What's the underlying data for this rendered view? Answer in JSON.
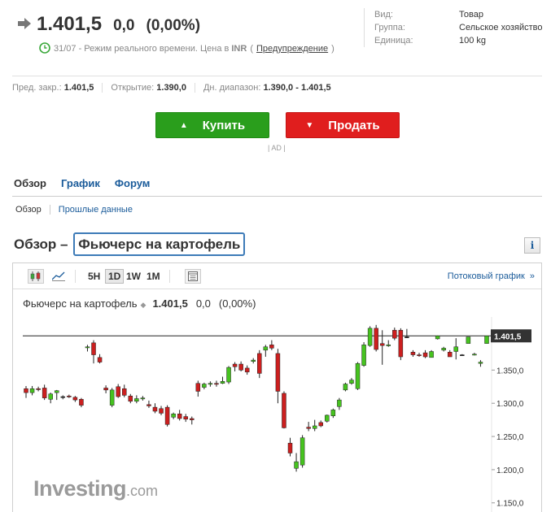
{
  "quote": {
    "price": "1.401,5",
    "change": "0,0",
    "change_pct": "(0,00%)",
    "time_text": "31/07 - Режим реального времени. Цена в",
    "currency": "INR",
    "paren_open": "(",
    "warning_link": "Предупреждение",
    "paren_close": ")"
  },
  "meta": [
    {
      "k": "Вид:",
      "v": "Товар"
    },
    {
      "k": "Группа:",
      "v": "Сельское хозяйство"
    },
    {
      "k": "Единица:",
      "v": "100 kg"
    }
  ],
  "stats": {
    "prev_label": "Пред. закр.:",
    "prev_value": "1.401,5",
    "open_label": "Открытие:",
    "open_value": "1.390,0",
    "range_label": "Дн. диапазон:",
    "range_value": "1.390,0 - 1.401,5"
  },
  "buttons": {
    "buy": "Купить",
    "sell": "Продать",
    "ad": "| AD |"
  },
  "tabs": [
    "Обзор",
    "График",
    "Форум"
  ],
  "subtabs": [
    "Обзор",
    "Прошлые данные"
  ],
  "section": {
    "prefix": "Обзор –",
    "title": "Фьючерс на картофель"
  },
  "info_label": "i",
  "chart_toolbar": {
    "timeframes": [
      "5H",
      "1D",
      "1W",
      "1M"
    ],
    "selected": "1D",
    "stream_link": "Потоковый график",
    "stream_chev": "»"
  },
  "chart_legend": {
    "name": "Фьючерс на картофель",
    "price": "1.401,5",
    "change": "0,0",
    "change_pct": "(0,00%)"
  },
  "watermark": {
    "main": "Investing",
    "suffix": ".com"
  },
  "colors": {
    "up": "#46c31f",
    "down": "#cc1f1f",
    "buy": "#2a9e1c",
    "sell": "#e01e1e",
    "link": "#1a5b9a"
  },
  "chart_data": {
    "type": "candlestick",
    "ylim": [
      1135,
      1430
    ],
    "y_ticks": [
      1150,
      1200,
      1250,
      1300,
      1350
    ],
    "y_tick_labels": [
      "1.150,0",
      "1.200,0",
      "1.250,0",
      "1.300,0",
      "1.350,0"
    ],
    "last_price": 1401.5,
    "last_price_label": "1.401,5",
    "candles": [
      {
        "o": 1322,
        "h": 1326,
        "l": 1308,
        "c": 1316
      },
      {
        "o": 1316,
        "h": 1326,
        "l": 1312,
        "c": 1322
      },
      {
        "o": 1322,
        "h": 1325,
        "l": 1318,
        "c": 1321
      },
      {
        "o": 1323,
        "h": 1328,
        "l": 1305,
        "c": 1308
      },
      {
        "o": 1306,
        "h": 1316,
        "l": 1300,
        "c": 1314
      },
      {
        "o": 1316,
        "h": 1320,
        "l": 1305,
        "c": 1319
      },
      {
        "o": 1310,
        "h": 1312,
        "l": 1306,
        "c": 1310
      },
      {
        "o": 1311,
        "h": 1313,
        "l": 1308,
        "c": 1310
      },
      {
        "o": 1309,
        "h": 1311,
        "l": 1302,
        "c": 1305
      },
      {
        "o": 1306,
        "h": 1308,
        "l": 1294,
        "c": 1297
      },
      {
        "o": 1384,
        "h": 1388,
        "l": 1378,
        "c": 1385
      },
      {
        "o": 1391,
        "h": 1395,
        "l": 1360,
        "c": 1373
      },
      {
        "o": 1369,
        "h": 1374,
        "l": 1360,
        "c": 1362
      },
      {
        "o": 1323,
        "h": 1327,
        "l": 1315,
        "c": 1320
      },
      {
        "o": 1297,
        "h": 1323,
        "l": 1294,
        "c": 1320
      },
      {
        "o": 1325,
        "h": 1329,
        "l": 1308,
        "c": 1310
      },
      {
        "o": 1322,
        "h": 1328,
        "l": 1309,
        "c": 1312
      },
      {
        "o": 1311,
        "h": 1314,
        "l": 1300,
        "c": 1303
      },
      {
        "o": 1303,
        "h": 1312,
        "l": 1300,
        "c": 1307
      },
      {
        "o": 1307,
        "h": 1311,
        "l": 1304,
        "c": 1308
      },
      {
        "o": 1298,
        "h": 1304,
        "l": 1293,
        "c": 1296
      },
      {
        "o": 1294,
        "h": 1300,
        "l": 1285,
        "c": 1288
      },
      {
        "o": 1292,
        "h": 1296,
        "l": 1282,
        "c": 1285
      },
      {
        "o": 1294,
        "h": 1297,
        "l": 1265,
        "c": 1268
      },
      {
        "o": 1279,
        "h": 1286,
        "l": 1276,
        "c": 1284
      },
      {
        "o": 1284,
        "h": 1290,
        "l": 1274,
        "c": 1277
      },
      {
        "o": 1280,
        "h": 1284,
        "l": 1272,
        "c": 1276
      },
      {
        "o": 1277,
        "h": 1280,
        "l": 1268,
        "c": 1275
      },
      {
        "o": 1330,
        "h": 1334,
        "l": 1310,
        "c": 1318
      },
      {
        "o": 1324,
        "h": 1331,
        "l": 1321,
        "c": 1329
      },
      {
        "o": 1329,
        "h": 1333,
        "l": 1325,
        "c": 1330
      },
      {
        "o": 1330,
        "h": 1334,
        "l": 1325,
        "c": 1329
      },
      {
        "o": 1330,
        "h": 1340,
        "l": 1329,
        "c": 1333
      },
      {
        "o": 1332,
        "h": 1356,
        "l": 1329,
        "c": 1354
      },
      {
        "o": 1359,
        "h": 1362,
        "l": 1348,
        "c": 1355
      },
      {
        "o": 1359,
        "h": 1363,
        "l": 1348,
        "c": 1350
      },
      {
        "o": 1353,
        "h": 1357,
        "l": 1343,
        "c": 1347
      },
      {
        "o": 1363,
        "h": 1368,
        "l": 1360,
        "c": 1365
      },
      {
        "o": 1375,
        "h": 1380,
        "l": 1338,
        "c": 1345
      },
      {
        "o": 1380,
        "h": 1388,
        "l": 1370,
        "c": 1385
      },
      {
        "o": 1388,
        "h": 1395,
        "l": 1380,
        "c": 1383
      },
      {
        "o": 1375,
        "h": 1382,
        "l": 1300,
        "c": 1318
      },
      {
        "o": 1315,
        "h": 1318,
        "l": 1262,
        "c": 1263
      },
      {
        "o": 1240,
        "h": 1248,
        "l": 1220,
        "c": 1225
      },
      {
        "o": 1202,
        "h": 1225,
        "l": 1197,
        "c": 1212
      },
      {
        "o": 1207,
        "h": 1252,
        "l": 1203,
        "c": 1248
      },
      {
        "o": 1264,
        "h": 1272,
        "l": 1258,
        "c": 1262
      },
      {
        "o": 1262,
        "h": 1275,
        "l": 1258,
        "c": 1266
      },
      {
        "o": 1271,
        "h": 1274,
        "l": 1264,
        "c": 1266
      },
      {
        "o": 1273,
        "h": 1283,
        "l": 1271,
        "c": 1282
      },
      {
        "o": 1281,
        "h": 1292,
        "l": 1278,
        "c": 1290
      },
      {
        "o": 1295,
        "h": 1308,
        "l": 1290,
        "c": 1305
      },
      {
        "o": 1320,
        "h": 1331,
        "l": 1318,
        "c": 1329
      },
      {
        "o": 1330,
        "h": 1338,
        "l": 1328,
        "c": 1335
      },
      {
        "o": 1322,
        "h": 1362,
        "l": 1320,
        "c": 1360
      },
      {
        "o": 1357,
        "h": 1392,
        "l": 1355,
        "c": 1388
      },
      {
        "o": 1387,
        "h": 1416,
        "l": 1385,
        "c": 1413
      },
      {
        "o": 1413,
        "h": 1418,
        "l": 1378,
        "c": 1381
      },
      {
        "o": 1390,
        "h": 1410,
        "l": 1358,
        "c": 1387
      },
      {
        "o": 1387,
        "h": 1395,
        "l": 1385,
        "c": 1388
      },
      {
        "o": 1410,
        "h": 1414,
        "l": 1395,
        "c": 1398
      },
      {
        "o": 1410,
        "h": 1413,
        "l": 1365,
        "c": 1370
      },
      {
        "o": 1400,
        "h": 1412,
        "l": 1400,
        "c": 1400
      },
      {
        "o": 1377,
        "h": 1380,
        "l": 1370,
        "c": 1373
      },
      {
        "o": 1373,
        "h": 1376,
        "l": 1370,
        "c": 1372
      },
      {
        "o": 1376,
        "h": 1380,
        "l": 1368,
        "c": 1370
      },
      {
        "o": 1369,
        "h": 1380,
        "l": 1369,
        "c": 1378
      },
      {
        "o": 1397,
        "h": 1402,
        "l": 1396,
        "c": 1401.5
      },
      {
        "o": 1380,
        "h": 1385,
        "l": 1378,
        "c": 1383
      },
      {
        "o": 1377,
        "h": 1380,
        "l": 1370,
        "c": 1370
      },
      {
        "o": 1378,
        "h": 1398,
        "l": 1366,
        "c": 1385
      },
      {
        "o": 1373,
        "h": 1374,
        "l": 1372,
        "c": 1373
      },
      {
        "o": 1390,
        "h": 1400,
        "l": 1390,
        "c": 1400
      },
      {
        "o": 1373,
        "h": 1376,
        "l": 1372,
        "c": 1374
      },
      {
        "o": 1360,
        "h": 1365,
        "l": 1355,
        "c": 1362
      },
      {
        "o": 1390,
        "h": 1401.5,
        "l": 1390,
        "c": 1401.5
      }
    ]
  }
}
